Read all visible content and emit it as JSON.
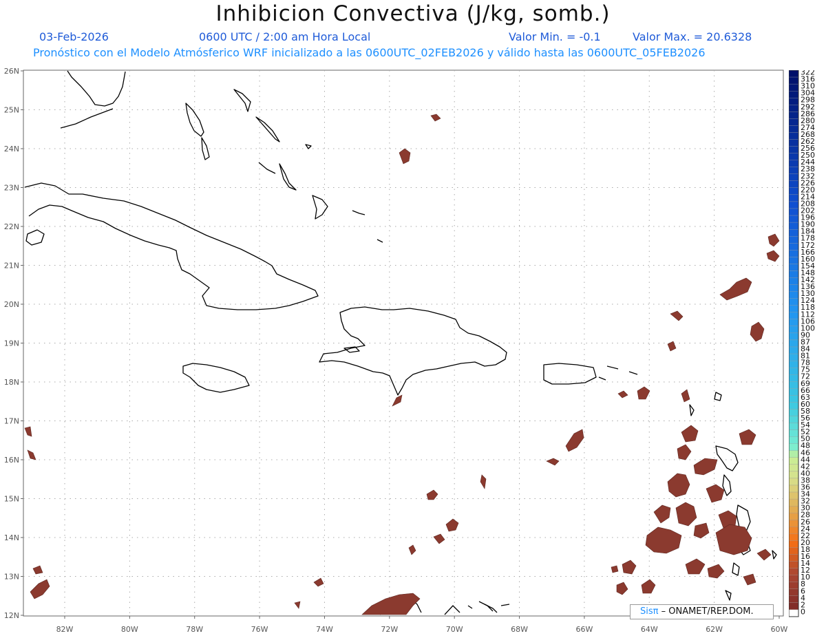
{
  "header": {
    "title": "Inhibicion Convectiva (J/kg, somb.)",
    "date": "03-Feb-2026",
    "time": "0600 UTC / 2:00 am Hora Local",
    "vmin": "Valor Min. = -0.1",
    "vmax": "Valor Max. = 20.6328",
    "forecast": "Pronóstico con el Modelo Atmósferico WRF inicializado a las 0600UTC_02FEB2026 y válido hasta las  0600UTC_05FEB2026"
  },
  "axes": {
    "lat_labels": [
      "26N",
      "25N",
      "24N",
      "23N",
      "22N",
      "21N",
      "20N",
      "19N",
      "18N",
      "17N",
      "16N",
      "15N",
      "14N",
      "13N",
      "12N"
    ],
    "lon_labels": [
      "82W",
      "80W",
      "78W",
      "76W",
      "74W",
      "72W",
      "70W",
      "68W",
      "66W",
      "64W",
      "62W",
      "60W"
    ]
  },
  "colorbar": {
    "labels": [
      "322",
      "316",
      "310",
      "304",
      "298",
      "292",
      "286",
      "280",
      "274",
      "268",
      "262",
      "256",
      "250",
      "244",
      "238",
      "232",
      "226",
      "220",
      "214",
      "208",
      "202",
      "196",
      "190",
      "184",
      "178",
      "172",
      "166",
      "160",
      "154",
      "148",
      "142",
      "136",
      "130",
      "124",
      "118",
      "112",
      "106",
      "100",
      "90",
      "87",
      "84",
      "81",
      "78",
      "75",
      "72",
      "69",
      "66",
      "63",
      "60",
      "58",
      "56",
      "54",
      "52",
      "50",
      "48",
      "46",
      "44",
      "42",
      "40",
      "38",
      "36",
      "34",
      "32",
      "30",
      "28",
      "26",
      "24",
      "22",
      "20",
      "18",
      "16",
      "14",
      "12",
      "10",
      "8",
      "6",
      "4",
      "2",
      "0"
    ]
  },
  "credit": {
    "brand": "Sisπ",
    "text": " – ONAMET/REP.DOM."
  },
  "colors": {
    "cin_fill": "#8b3a2f",
    "coast": "#000000",
    "grid": "#a9a9a9",
    "title_blue": "#1f5bd8",
    "subtitle_blue": "#1e90ff"
  }
}
